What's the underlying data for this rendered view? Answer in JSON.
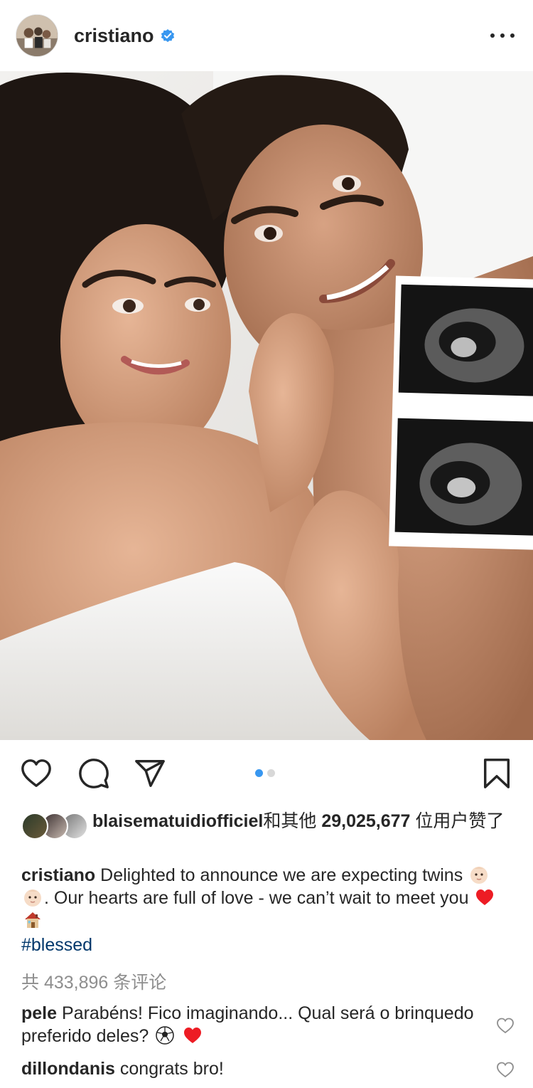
{
  "post": {
    "username": "cristiano",
    "verified": true,
    "more_icon": "more-horizontal-icon"
  },
  "carousel": {
    "current": 1,
    "total": 2
  },
  "likes": {
    "user": "blaisematuidiofficiel",
    "text": "和其他",
    "count": "29,025,677",
    "suffix": "位用户赞了"
  },
  "caption": {
    "username": "cristiano",
    "line_a": "Delighted to announce we are expecting twins",
    "line_b": ". Our hearts are full of love - we can’t wait to meet you",
    "hashtag": "#blessed"
  },
  "comments_count": "共 433,896 条评论",
  "comments": [
    {
      "user": "pele",
      "text": "Parabéns! Fico imaginando... Qual será o brinquedo preferido deles?"
    },
    {
      "user": "dillondanis",
      "text": "congrats bro!"
    }
  ],
  "colors": {
    "accent": "#3897f0",
    "hashtag": "#00376b",
    "muted": "#8e8e8e",
    "heart_red": "#ed1c24"
  }
}
